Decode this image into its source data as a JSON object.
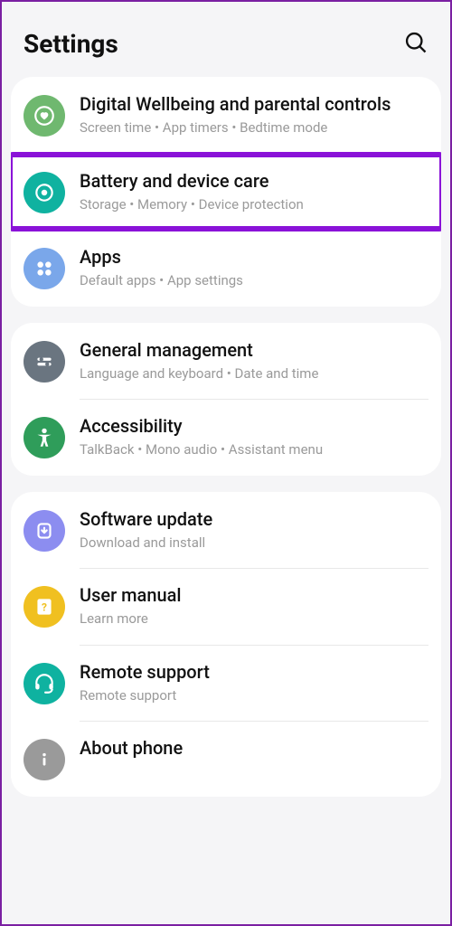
{
  "header": {
    "title": "Settings"
  },
  "groups": [
    {
      "items": [
        {
          "title": "Digital Wellbeing and parental controls",
          "subtitle": "Screen time  •  App timers  •  Bedtime mode"
        },
        {
          "title": "Battery and device care",
          "subtitle": "Storage  •  Memory  •  Device protection",
          "highlighted": true
        },
        {
          "title": "Apps",
          "subtitle": "Default apps  •  App settings"
        }
      ]
    },
    {
      "items": [
        {
          "title": "General management",
          "subtitle": "Language and keyboard  •  Date and time"
        },
        {
          "title": "Accessibility",
          "subtitle": "TalkBack  •  Mono audio  •  Assistant menu"
        }
      ]
    },
    {
      "items": [
        {
          "title": "Software update",
          "subtitle": "Download and install"
        },
        {
          "title": "User manual",
          "subtitle": "Learn more"
        },
        {
          "title": "Remote support",
          "subtitle": "Remote support"
        },
        {
          "title": "About phone",
          "subtitle": ""
        }
      ]
    }
  ]
}
